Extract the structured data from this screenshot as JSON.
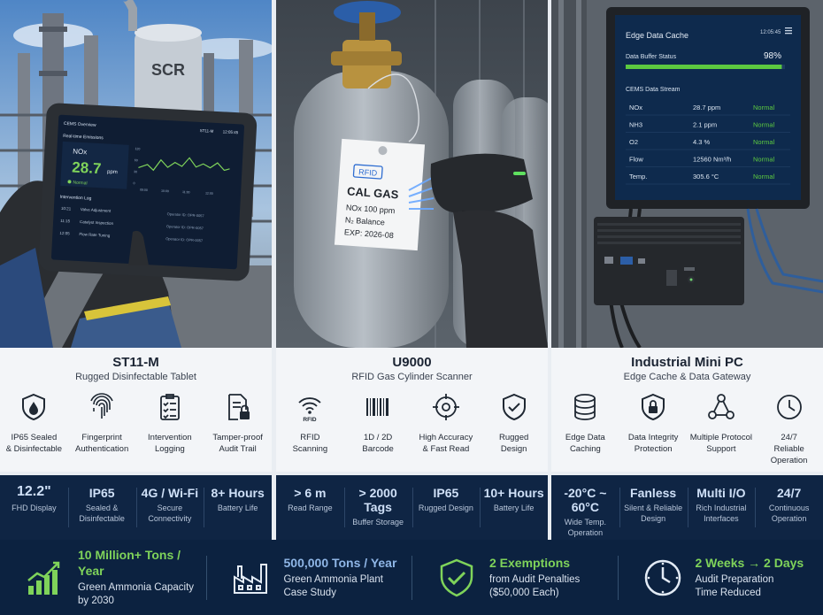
{
  "products": [
    {
      "name": "ST11-M",
      "subtitle": "Rugged Disinfectable Tablet",
      "screen": {
        "back": "CEMS Overview",
        "id": "ST11-M",
        "time": "12:05:45",
        "section": "Real-time Emissions",
        "metric": "NOx",
        "value": "28.7",
        "unit": "ppm",
        "status": "Normal",
        "log_title": "Intervention Log",
        "log": [
          {
            "time": "10:21",
            "action": "Valve Adjustment",
            "op": "Operator ID: OPR-0057"
          },
          {
            "time": "11:15",
            "action": "Catalyst Inspection",
            "op": "Operator ID: OPR-0057"
          },
          {
            "time": "12:05",
            "action": "Flow Rate Tuning",
            "op": "Operator ID: OPR-0057"
          }
        ],
        "axis_y": [
          "120",
          "60",
          "30",
          "0"
        ],
        "axis_x": [
          "09:00",
          "10:00",
          "11:00",
          "12:00"
        ]
      },
      "features": [
        {
          "icon": "water-drop-shield-icon",
          "label": "IP65 Sealed\n& Disinfectable"
        },
        {
          "icon": "fingerprint-icon",
          "label": "Fingerprint\nAuthentication"
        },
        {
          "icon": "checklist-icon",
          "label": "Intervention\nLogging"
        },
        {
          "icon": "locked-document-icon",
          "label": "Tamper-proof\nAudit Trail"
        }
      ],
      "stats": [
        {
          "value": "12.2\"",
          "label": "FHD Display"
        },
        {
          "value": "IP65",
          "label": "Sealed &\nDisinfectable"
        },
        {
          "value": "4G / Wi-Fi",
          "label": "Secure\nConnectivity"
        },
        {
          "value": "8+ Hours",
          "label": "Battery Life"
        }
      ]
    },
    {
      "name": "U9000",
      "subtitle": "RFID Gas Cylinder Scanner",
      "tag": {
        "rfid": "RFID",
        "title": "CAL GAS",
        "line1": "NOx 100 ppm",
        "line2": "N₂ Balance",
        "line3": "EXP: 2026-08"
      },
      "features": [
        {
          "icon": "rfid-icon",
          "label": "RFID\nScanning"
        },
        {
          "icon": "barcode-icon",
          "label": "1D / 2D\nBarcode"
        },
        {
          "icon": "crosshair-icon",
          "label": "High Accuracy\n& Fast Read"
        },
        {
          "icon": "shield-check-icon",
          "label": "Rugged\nDesign"
        }
      ],
      "stats": [
        {
          "value": "> 6 m",
          "label": "Read Range"
        },
        {
          "value": "> 2000 Tags",
          "label": "Buffer Storage"
        },
        {
          "value": "IP65",
          "label": "Rugged Design"
        },
        {
          "value": "10+ Hours",
          "label": "Battery Life"
        }
      ]
    },
    {
      "name": "Industrial Mini PC",
      "subtitle": "Edge Cache & Data Gateway",
      "screen": {
        "title": "Edge Data Cache",
        "time": "12:05:45",
        "buffer_label": "Data Buffer Status",
        "buffer_value": "98%",
        "buffer_level": 0.98,
        "stream_title": "CEMS Data Stream",
        "rows": [
          {
            "name": "NOx",
            "value": "28.7 ppm",
            "status": "Normal"
          },
          {
            "name": "NH3",
            "value": "2.1 ppm",
            "status": "Normal"
          },
          {
            "name": "O2",
            "value": "4.3 %",
            "status": "Normal"
          },
          {
            "name": "Flow",
            "value": "12560 Nm³/h",
            "status": "Normal"
          },
          {
            "name": "Temp.",
            "value": "305.6 °C",
            "status": "Normal"
          }
        ]
      },
      "features": [
        {
          "icon": "database-icon",
          "label": "Edge Data\nCaching"
        },
        {
          "icon": "shield-lock-icon",
          "label": "Data Integrity\nProtection"
        },
        {
          "icon": "network-nodes-icon",
          "label": "Multiple Protocol\nSupport"
        },
        {
          "icon": "clock-icon",
          "label": "24/7\nReliable Operation"
        }
      ],
      "stats": [
        {
          "value": "-20°C ~ 60°C",
          "label": "Wide Temp.\nOperation"
        },
        {
          "value": "Fanless",
          "label": "Silent & Reliable\nDesign"
        },
        {
          "value": "Multi I/O",
          "label": "Rich Industrial\nInterfaces"
        },
        {
          "value": "24/7",
          "label": "Continuous\nOperation"
        }
      ]
    }
  ],
  "scene": {
    "tank_label": "SCR"
  },
  "kpis": [
    {
      "icon": "growth-chart-icon",
      "title": "10 Million+ Tons / Year",
      "desc1": "Green Ammonia Capacity",
      "desc2": "by 2030",
      "color": "#7fd35a"
    },
    {
      "icon": "factory-icon",
      "title": "500,000 Tons / Year",
      "desc1": "Green Ammonia Plant",
      "desc2": "Case Study",
      "color": "#8fb6e6"
    },
    {
      "icon": "shield-check-icon",
      "title": "2 Exemptions",
      "desc1": "from Audit Penalties",
      "desc2": "($50,000 Each)",
      "color": "#7fd35a"
    },
    {
      "icon": "clock-icon",
      "title": "2 Weeks → 2 Days",
      "desc1": "Audit Preparation",
      "desc2": "Time Reduced",
      "color": "#7fd35a"
    }
  ]
}
